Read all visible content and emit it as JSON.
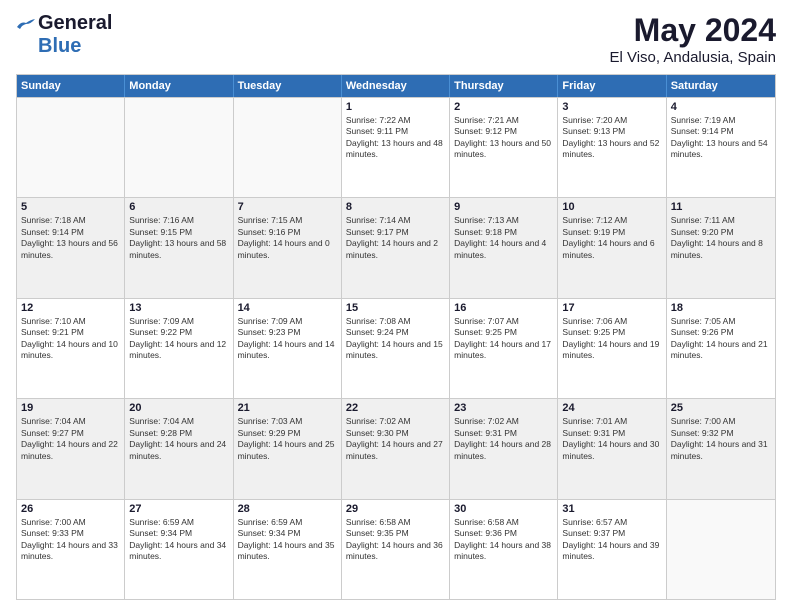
{
  "header": {
    "logo_general": "General",
    "logo_blue": "Blue",
    "title": "May 2024",
    "subtitle": "El Viso, Andalusia, Spain"
  },
  "days_of_week": [
    "Sunday",
    "Monday",
    "Tuesday",
    "Wednesday",
    "Thursday",
    "Friday",
    "Saturday"
  ],
  "weeks": [
    [
      {
        "day": "",
        "sunrise": "",
        "sunset": "",
        "daylight": "",
        "empty": true
      },
      {
        "day": "",
        "sunrise": "",
        "sunset": "",
        "daylight": "",
        "empty": true
      },
      {
        "day": "",
        "sunrise": "",
        "sunset": "",
        "daylight": "",
        "empty": true
      },
      {
        "day": "1",
        "sunrise": "Sunrise: 7:22 AM",
        "sunset": "Sunset: 9:11 PM",
        "daylight": "Daylight: 13 hours and 48 minutes.",
        "empty": false
      },
      {
        "day": "2",
        "sunrise": "Sunrise: 7:21 AM",
        "sunset": "Sunset: 9:12 PM",
        "daylight": "Daylight: 13 hours and 50 minutes.",
        "empty": false
      },
      {
        "day": "3",
        "sunrise": "Sunrise: 7:20 AM",
        "sunset": "Sunset: 9:13 PM",
        "daylight": "Daylight: 13 hours and 52 minutes.",
        "empty": false
      },
      {
        "day": "4",
        "sunrise": "Sunrise: 7:19 AM",
        "sunset": "Sunset: 9:14 PM",
        "daylight": "Daylight: 13 hours and 54 minutes.",
        "empty": false
      }
    ],
    [
      {
        "day": "5",
        "sunrise": "Sunrise: 7:18 AM",
        "sunset": "Sunset: 9:14 PM",
        "daylight": "Daylight: 13 hours and 56 minutes.",
        "empty": false
      },
      {
        "day": "6",
        "sunrise": "Sunrise: 7:16 AM",
        "sunset": "Sunset: 9:15 PM",
        "daylight": "Daylight: 13 hours and 58 minutes.",
        "empty": false
      },
      {
        "day": "7",
        "sunrise": "Sunrise: 7:15 AM",
        "sunset": "Sunset: 9:16 PM",
        "daylight": "Daylight: 14 hours and 0 minutes.",
        "empty": false
      },
      {
        "day": "8",
        "sunrise": "Sunrise: 7:14 AM",
        "sunset": "Sunset: 9:17 PM",
        "daylight": "Daylight: 14 hours and 2 minutes.",
        "empty": false
      },
      {
        "day": "9",
        "sunrise": "Sunrise: 7:13 AM",
        "sunset": "Sunset: 9:18 PM",
        "daylight": "Daylight: 14 hours and 4 minutes.",
        "empty": false
      },
      {
        "day": "10",
        "sunrise": "Sunrise: 7:12 AM",
        "sunset": "Sunset: 9:19 PM",
        "daylight": "Daylight: 14 hours and 6 minutes.",
        "empty": false
      },
      {
        "day": "11",
        "sunrise": "Sunrise: 7:11 AM",
        "sunset": "Sunset: 9:20 PM",
        "daylight": "Daylight: 14 hours and 8 minutes.",
        "empty": false
      }
    ],
    [
      {
        "day": "12",
        "sunrise": "Sunrise: 7:10 AM",
        "sunset": "Sunset: 9:21 PM",
        "daylight": "Daylight: 14 hours and 10 minutes.",
        "empty": false
      },
      {
        "day": "13",
        "sunrise": "Sunrise: 7:09 AM",
        "sunset": "Sunset: 9:22 PM",
        "daylight": "Daylight: 14 hours and 12 minutes.",
        "empty": false
      },
      {
        "day": "14",
        "sunrise": "Sunrise: 7:09 AM",
        "sunset": "Sunset: 9:23 PM",
        "daylight": "Daylight: 14 hours and 14 minutes.",
        "empty": false
      },
      {
        "day": "15",
        "sunrise": "Sunrise: 7:08 AM",
        "sunset": "Sunset: 9:24 PM",
        "daylight": "Daylight: 14 hours and 15 minutes.",
        "empty": false
      },
      {
        "day": "16",
        "sunrise": "Sunrise: 7:07 AM",
        "sunset": "Sunset: 9:25 PM",
        "daylight": "Daylight: 14 hours and 17 minutes.",
        "empty": false
      },
      {
        "day": "17",
        "sunrise": "Sunrise: 7:06 AM",
        "sunset": "Sunset: 9:25 PM",
        "daylight": "Daylight: 14 hours and 19 minutes.",
        "empty": false
      },
      {
        "day": "18",
        "sunrise": "Sunrise: 7:05 AM",
        "sunset": "Sunset: 9:26 PM",
        "daylight": "Daylight: 14 hours and 21 minutes.",
        "empty": false
      }
    ],
    [
      {
        "day": "19",
        "sunrise": "Sunrise: 7:04 AM",
        "sunset": "Sunset: 9:27 PM",
        "daylight": "Daylight: 14 hours and 22 minutes.",
        "empty": false
      },
      {
        "day": "20",
        "sunrise": "Sunrise: 7:04 AM",
        "sunset": "Sunset: 9:28 PM",
        "daylight": "Daylight: 14 hours and 24 minutes.",
        "empty": false
      },
      {
        "day": "21",
        "sunrise": "Sunrise: 7:03 AM",
        "sunset": "Sunset: 9:29 PM",
        "daylight": "Daylight: 14 hours and 25 minutes.",
        "empty": false
      },
      {
        "day": "22",
        "sunrise": "Sunrise: 7:02 AM",
        "sunset": "Sunset: 9:30 PM",
        "daylight": "Daylight: 14 hours and 27 minutes.",
        "empty": false
      },
      {
        "day": "23",
        "sunrise": "Sunrise: 7:02 AM",
        "sunset": "Sunset: 9:31 PM",
        "daylight": "Daylight: 14 hours and 28 minutes.",
        "empty": false
      },
      {
        "day": "24",
        "sunrise": "Sunrise: 7:01 AM",
        "sunset": "Sunset: 9:31 PM",
        "daylight": "Daylight: 14 hours and 30 minutes.",
        "empty": false
      },
      {
        "day": "25",
        "sunrise": "Sunrise: 7:00 AM",
        "sunset": "Sunset: 9:32 PM",
        "daylight": "Daylight: 14 hours and 31 minutes.",
        "empty": false
      }
    ],
    [
      {
        "day": "26",
        "sunrise": "Sunrise: 7:00 AM",
        "sunset": "Sunset: 9:33 PM",
        "daylight": "Daylight: 14 hours and 33 minutes.",
        "empty": false
      },
      {
        "day": "27",
        "sunrise": "Sunrise: 6:59 AM",
        "sunset": "Sunset: 9:34 PM",
        "daylight": "Daylight: 14 hours and 34 minutes.",
        "empty": false
      },
      {
        "day": "28",
        "sunrise": "Sunrise: 6:59 AM",
        "sunset": "Sunset: 9:34 PM",
        "daylight": "Daylight: 14 hours and 35 minutes.",
        "empty": false
      },
      {
        "day": "29",
        "sunrise": "Sunrise: 6:58 AM",
        "sunset": "Sunset: 9:35 PM",
        "daylight": "Daylight: 14 hours and 36 minutes.",
        "empty": false
      },
      {
        "day": "30",
        "sunrise": "Sunrise: 6:58 AM",
        "sunset": "Sunset: 9:36 PM",
        "daylight": "Daylight: 14 hours and 38 minutes.",
        "empty": false
      },
      {
        "day": "31",
        "sunrise": "Sunrise: 6:57 AM",
        "sunset": "Sunset: 9:37 PM",
        "daylight": "Daylight: 14 hours and 39 minutes.",
        "empty": false
      },
      {
        "day": "",
        "sunrise": "",
        "sunset": "",
        "daylight": "",
        "empty": true
      }
    ]
  ]
}
